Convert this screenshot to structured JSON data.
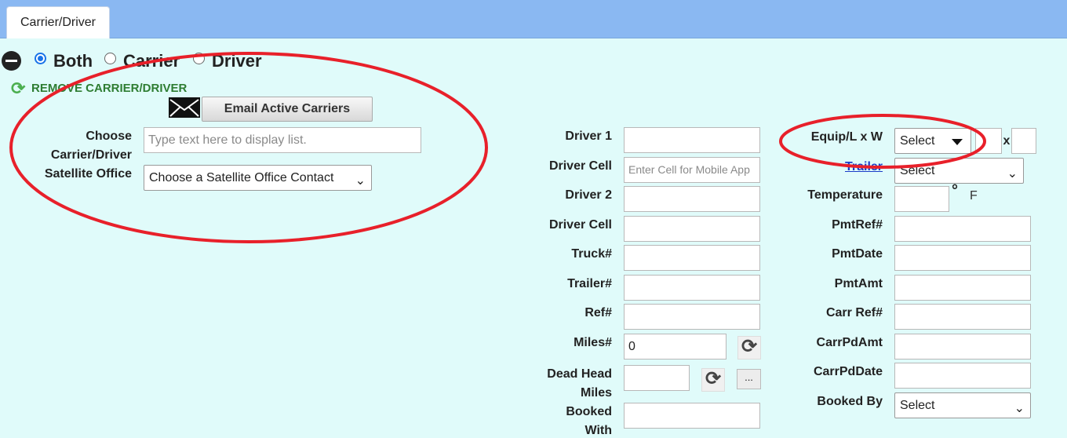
{
  "tabs": [
    {
      "label": "Carrier/Driver"
    }
  ],
  "mode": {
    "options": [
      {
        "label": "Both",
        "selected": true
      },
      {
        "label": "Carrier",
        "selected": false
      },
      {
        "label": "Driver",
        "selected": false
      }
    ]
  },
  "actions": {
    "remove_label": "REMOVE CARRIER/DRIVER",
    "email_button": "Email Active Carriers"
  },
  "carrier": {
    "choose_label_1": "Choose",
    "choose_label_2": "Carrier/Driver",
    "choose_placeholder": "Type text here to display list.",
    "satellite_label": "Satellite Office",
    "satellite_value": "Choose a Satellite Office Contact"
  },
  "driver_fields": {
    "driver1": {
      "label": "Driver 1",
      "value": ""
    },
    "driver_cell1": {
      "label": "Driver Cell",
      "placeholder": "Enter Cell for Mobile App"
    },
    "driver2": {
      "label": "Driver 2",
      "value": ""
    },
    "driver_cell2": {
      "label": "Driver Cell",
      "value": ""
    },
    "truck": {
      "label": "Truck#",
      "value": ""
    },
    "trailer_num": {
      "label": "Trailer#",
      "value": ""
    },
    "ref": {
      "label": "Ref#",
      "value": ""
    },
    "miles": {
      "label": "Miles#",
      "value": "0"
    },
    "dead_head_1": "Dead Head",
    "dead_head_2": "Miles",
    "booked_with_1": "Booked",
    "booked_with_2": "With"
  },
  "equip_fields": {
    "equip_label": "Equip/L x W",
    "equip_value": "Select",
    "x_label": "x",
    "trailer_link": "Trailer",
    "trailer_value": "Select",
    "temperature_label": "Temperature",
    "degree_symbol": "°",
    "unit": "F",
    "pmtref": "PmtRef#",
    "pmtdate": "PmtDate",
    "pmtamt": "PmtAmt",
    "carr_ref": "Carr Ref#",
    "carrpdamt": "CarrPdAmt",
    "carrpddate": "CarrPdDate",
    "booked_by": "Booked By",
    "booked_by_value": "Select"
  },
  "colors": {
    "accent": "#1a73e8",
    "annotation": "#e8202a",
    "header": "#8ab8f2",
    "background": "#e0fbfa"
  }
}
